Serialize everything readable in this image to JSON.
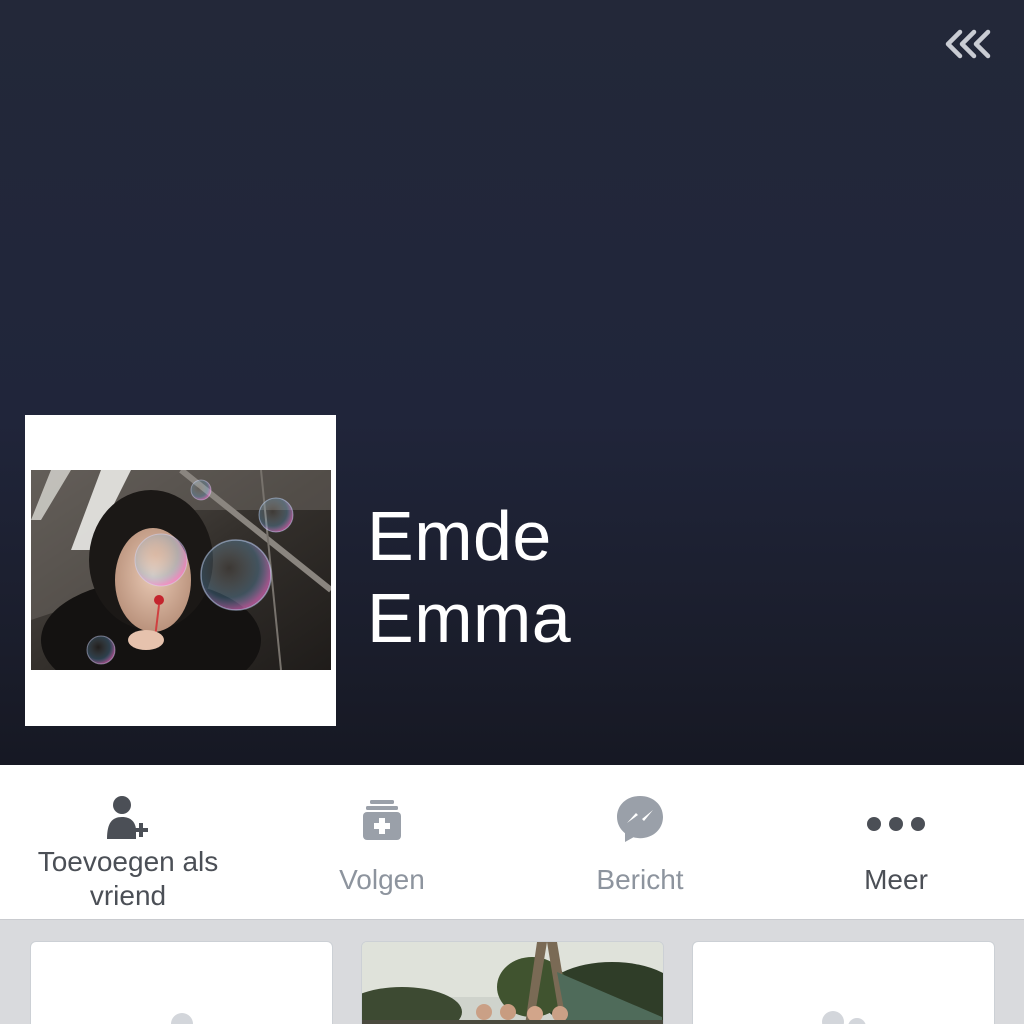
{
  "header": {
    "back_icon": "triple-chevron-left-icon"
  },
  "profile": {
    "first_name": "Emde",
    "last_name": "Emma",
    "avatar_icon": "profile-photo"
  },
  "actions": [
    {
      "label": "Toevoegen als vriend",
      "label_line1": "Toevoegen als",
      "label_line2": "vriend",
      "icon": "add-friend-icon"
    },
    {
      "label": "Volgen",
      "icon": "follow-icon"
    },
    {
      "label": "Bericht",
      "icon": "messenger-icon"
    },
    {
      "label": "Meer",
      "icon": "more-dots-icon"
    }
  ],
  "colors": {
    "cover_bg": "#232839",
    "action_dark": "#4b4f56",
    "action_muted": "#8d949e"
  }
}
